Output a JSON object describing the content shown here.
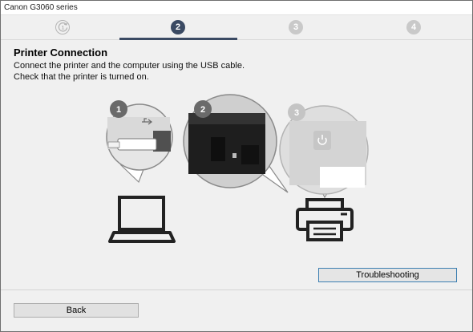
{
  "window": {
    "title": "Canon G3060 series"
  },
  "steps": [
    {
      "label": "1",
      "state": "done",
      "icon": "refresh-icon"
    },
    {
      "label": "2",
      "state": "active"
    },
    {
      "label": "3",
      "state": "todo"
    },
    {
      "label": "4",
      "state": "todo"
    }
  ],
  "page": {
    "heading": "Printer Connection",
    "line1": "Connect the printer and the computer using the USB cable.",
    "line2": "Check that the printer is turned on."
  },
  "illustration": {
    "callouts": [
      "1",
      "2",
      "3"
    ],
    "icons": [
      "usb-icon",
      "laptop-icon",
      "printer-icon",
      "power-icon"
    ]
  },
  "buttons": {
    "troubleshooting": "Troubleshooting",
    "back": "Back"
  },
  "colors": {
    "accent": "#3b4a63",
    "inactive_step": "#c9c9c9",
    "focus_border": "#3c7fb1"
  }
}
